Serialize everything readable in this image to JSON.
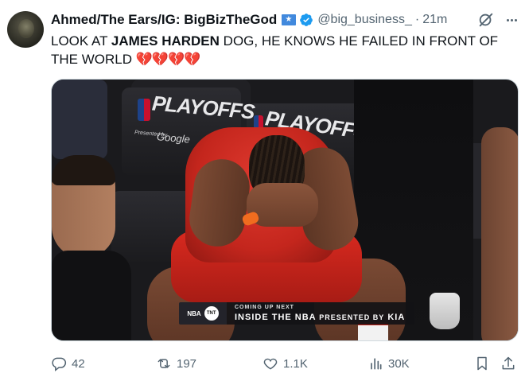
{
  "author": {
    "display_name": "Ahmed/The Ears/IG: BigBizTheGod",
    "handle": "@big_business_",
    "separator": "·",
    "timestamp": "21m",
    "flag_icon": "somalia-flag-icon",
    "verified_icon": "verified-badge-icon",
    "badge_color": "#1d9bf0"
  },
  "tweet": {
    "text_before": "LOOK AT ",
    "text_bold": "JAMES HARDEN",
    "text_after": " DOG, HE KNOWS HE FAILED IN FRONT OF THE WORLD ",
    "emoji": "💔💔💔💔"
  },
  "media": {
    "banner_left": "PLAYOFFS",
    "banner_left_sub": "Google",
    "banner_left_presented": "Presented by",
    "banner_center": "PLAYOFFS",
    "lower_third": {
      "network_left": "NBA",
      "network_right": "TNT",
      "kicker": "COMING UP NEXT",
      "title": "INSIDE THE NBA",
      "sponsor_prefix": "PRESENTED BY",
      "sponsor": "KIA"
    },
    "jersey_color": "#c4261d"
  },
  "actions": {
    "reply_count": "42",
    "retweet_count": "197",
    "like_count": "1.1K",
    "views_count": "30K"
  },
  "colors": {
    "text_primary": "#0f1419",
    "text_secondary": "#536471",
    "accent": "#1d9bf0",
    "border": "#cfd9de"
  }
}
